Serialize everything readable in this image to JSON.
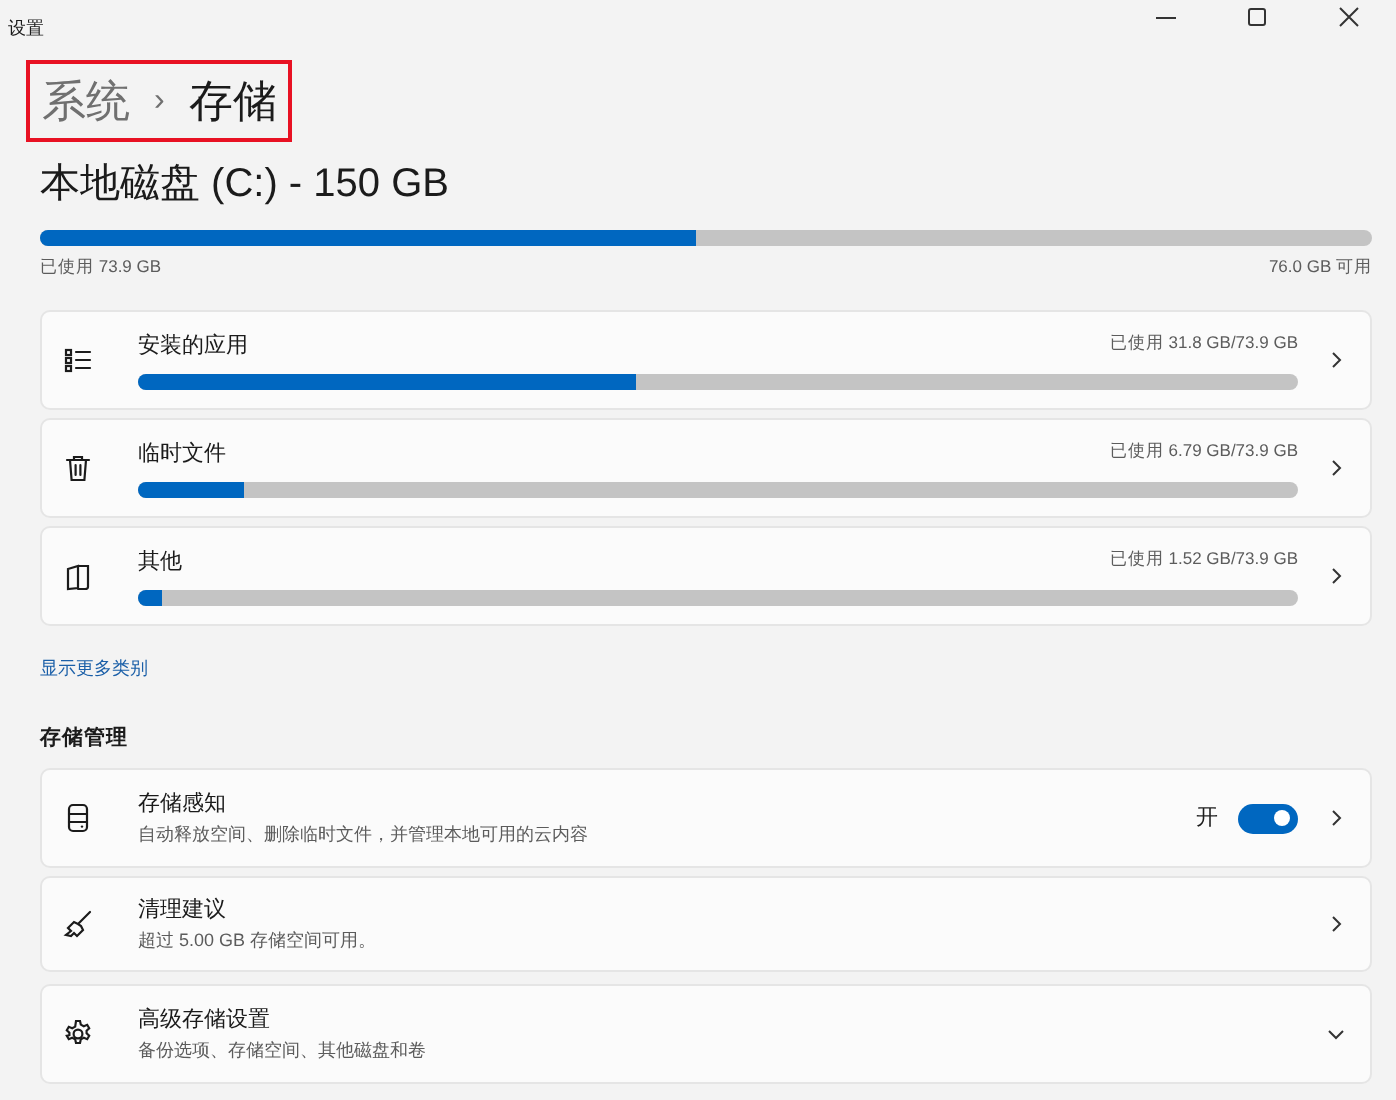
{
  "window": {
    "title": "设置"
  },
  "breadcrumb": {
    "items": [
      {
        "label": "系统",
        "selected": false
      },
      {
        "label": "存储",
        "selected": true
      }
    ],
    "separator": "›",
    "highlighted": true
  },
  "disk": {
    "title": "本地磁盘 (C:) - 150 GB",
    "level": 0.493,
    "used": "已使用 73.9 GB",
    "free": "76.0 GB 可用"
  },
  "categories": [
    {
      "label": "安装的应用",
      "usage": "已使用 31.8 GB/73.9 GB",
      "level": 0.43
    },
    {
      "label": "临时文件",
      "usage": "已使用 6.79 GB/73.9 GB",
      "level": 0.092
    },
    {
      "label": "其他",
      "usage": "已使用 1.52 GB/73.9 GB",
      "level": 0.021
    }
  ],
  "more_link": "显示更多类别",
  "management": {
    "heading": "存储管理",
    "items": [
      {
        "title": "存储感知",
        "description": "自动释放空间、删除临时文件，并管理本地可用的云内容",
        "toggle": {
          "label": "开",
          "on": true
        },
        "kind": "navigate"
      },
      {
        "title": "清理建议",
        "description": "超过 5.00 GB 存储空间可用。",
        "kind": "navigate"
      },
      {
        "title": "高级存储设置",
        "description": "备份选项、存储空间、其他磁盘和卷",
        "kind": "expand"
      }
    ]
  }
}
